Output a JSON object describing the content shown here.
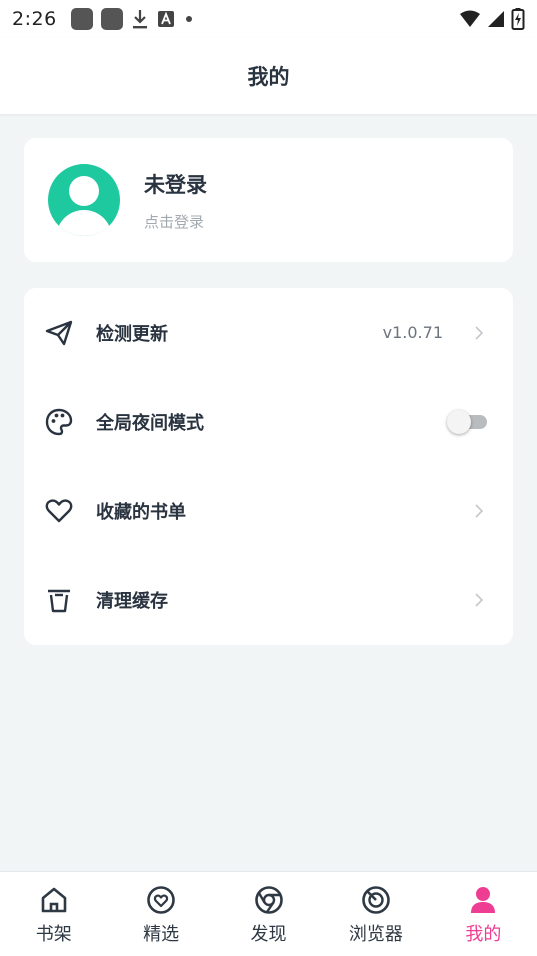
{
  "status_bar": {
    "time": "2:26",
    "icons": [
      "app-icon",
      "app-icon",
      "download-icon",
      "text-a-icon",
      "dot-icon",
      "wifi-icon",
      "signal-icon",
      "battery-charging-icon"
    ]
  },
  "header": {
    "title": "我的"
  },
  "profile": {
    "name": "未登录",
    "subtitle": "点击登录"
  },
  "menu": {
    "items": [
      {
        "icon": "paper-plane-icon",
        "label": "检测更新",
        "value": "v1.0.71",
        "type": "chevron"
      },
      {
        "icon": "palette-icon",
        "label": "全局夜间模式",
        "type": "toggle",
        "toggle_on": false
      },
      {
        "icon": "heart-icon",
        "label": "收藏的书单",
        "type": "chevron"
      },
      {
        "icon": "trash-icon",
        "label": "清理缓存",
        "type": "chevron"
      }
    ]
  },
  "bottom_nav": {
    "items": [
      {
        "icon": "home-icon",
        "label": "书架"
      },
      {
        "icon": "heart-circle-icon",
        "label": "精选"
      },
      {
        "icon": "aperture-icon",
        "label": "发现"
      },
      {
        "icon": "radar-icon",
        "label": "浏览器"
      },
      {
        "icon": "person-icon",
        "label": "我的",
        "active": true
      }
    ]
  },
  "colors": {
    "accent": "#ee3e93",
    "avatar": "#1fc9a0",
    "background": "#f2f5f6",
    "text_dark": "#2a3440"
  }
}
